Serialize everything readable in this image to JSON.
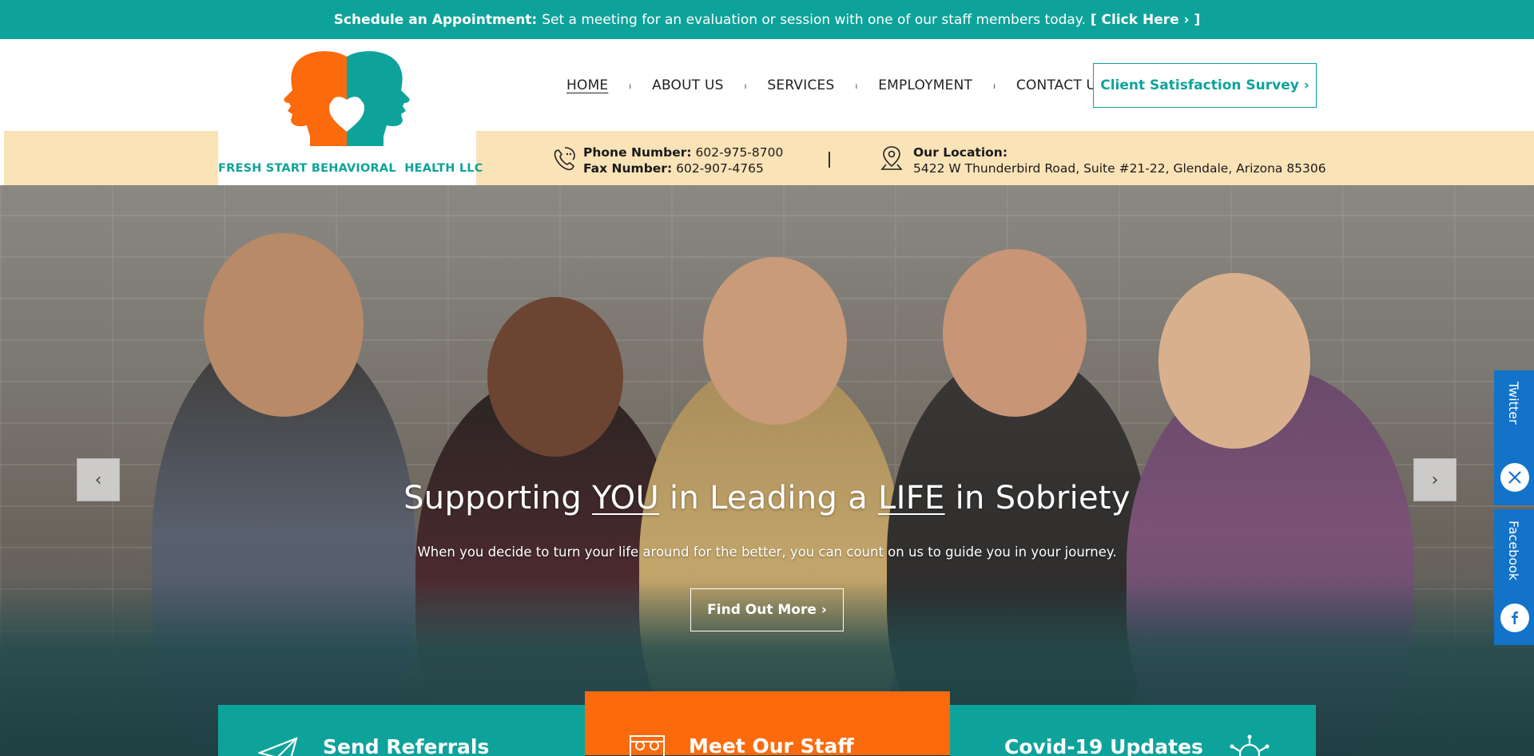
{
  "topbar": {
    "lead": "Schedule an Appointment:",
    "message": "Set a meeting for an evaluation or session with one of our staff members today.",
    "link": "[ Click Here › ]"
  },
  "logo": {
    "text": "FRESH START BEHAVIORAL  HEALTH LLC",
    "colors": {
      "orange": "#fb6a0d",
      "teal": "#0ea39a"
    }
  },
  "nav": {
    "items": [
      {
        "label": "HOME",
        "active": true
      },
      {
        "label": "ABOUT US",
        "active": false
      },
      {
        "label": "SERVICES",
        "active": false
      },
      {
        "label": "EMPLOYMENT",
        "active": false
      },
      {
        "label": "CONTACT US",
        "active": false
      }
    ],
    "separator": "ı"
  },
  "survey_button": {
    "label": "Client Satisfaction Survey ›"
  },
  "contact": {
    "phone_label": "Phone Number:",
    "phone": "602-975-8700",
    "fax_label": "Fax Number:",
    "fax": "602-907-4765",
    "location_label": "Our Location:",
    "address": "5422 W Thunderbird Road, Suite #21-22, Glendale, Arizona 85306"
  },
  "hero": {
    "title_part1": "Supporting ",
    "title_em1": "YOU",
    "title_part2": " in Leading a ",
    "title_em2": "LIFE",
    "title_part3": " in Sobriety",
    "subtitle": "When you decide to turn your life around for the better, you can count on us to guide you in your journey.",
    "button": "Find Out More ›",
    "prev_icon": "‹",
    "next_icon": "›"
  },
  "social": {
    "twitter": "Twitter",
    "facebook": "Facebook"
  },
  "cards": {
    "referrals": "Send Referrals",
    "staff": "Meet Our Staff",
    "covid": "Covid-19 Updates"
  },
  "colors": {
    "brand_teal": "#0ea39a",
    "brand_orange": "#fb6a0d",
    "info_strip": "#fbe3b8",
    "social_blue": "#1273c8"
  }
}
